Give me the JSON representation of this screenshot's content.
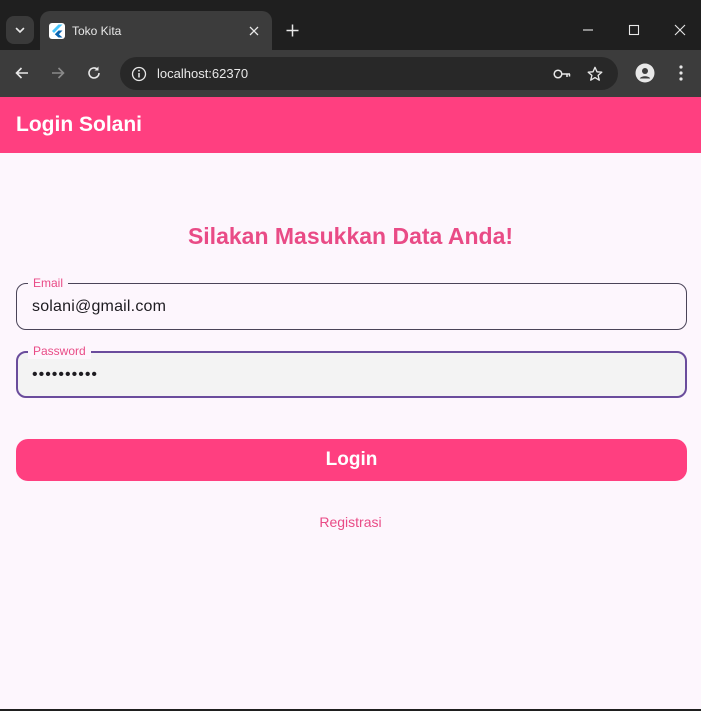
{
  "browser": {
    "tab": {
      "title": "Toko Kita",
      "favicon": "flutter-icon"
    },
    "address_bar": {
      "url": "localhost:62370"
    },
    "icons": {
      "tab_list": "chevron-down-icon",
      "close_tab": "close-icon",
      "new_tab": "plus-icon",
      "minimize": "minimize-icon",
      "maximize": "maximize-icon",
      "close_window": "close-icon",
      "back": "back-arrow-icon",
      "forward": "forward-arrow-icon",
      "reload": "reload-icon",
      "site_info": "info-icon",
      "passwords": "key-icon",
      "bookmark": "star-icon",
      "profile": "person-icon",
      "menu": "kebab-menu-icon"
    }
  },
  "app": {
    "appbar_title": "Login Solani",
    "heading": "Silakan Masukkan Data Anda!",
    "email": {
      "label": "Email",
      "value": "solani@gmail.com"
    },
    "password": {
      "label": "Password",
      "value": "••••••••••"
    },
    "login_button": "Login",
    "register_link": "Registrasi"
  },
  "colors": {
    "accent": "#ff3f80",
    "accent_text": "#e94b86",
    "background": "#fdf6fd",
    "focus_border": "#6a4c9c"
  }
}
